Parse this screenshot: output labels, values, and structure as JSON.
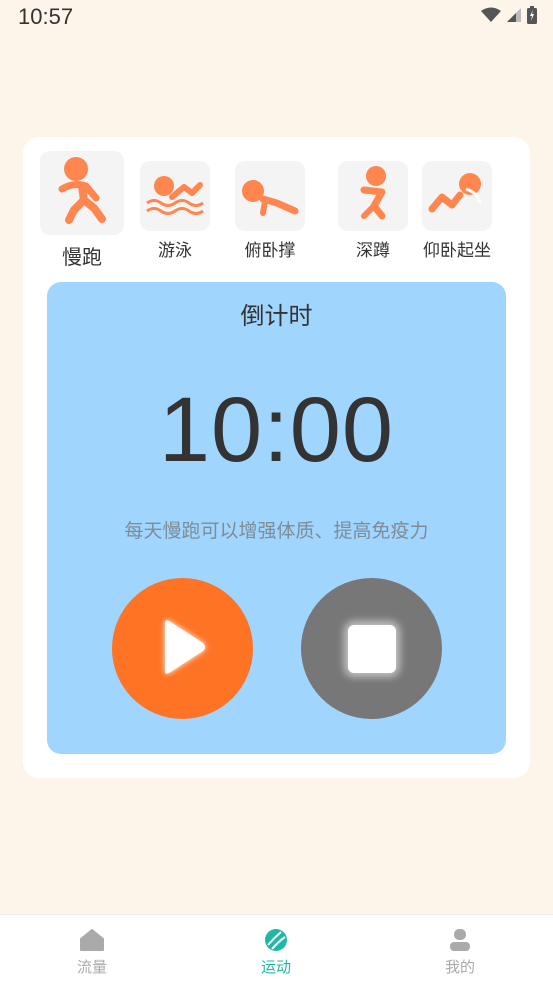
{
  "status_bar": {
    "time": "10:57"
  },
  "exercises": [
    {
      "label": "慢跑",
      "icon": "running-person-icon",
      "selected": true
    },
    {
      "label": "游泳",
      "icon": "swimming-person-icon",
      "selected": false
    },
    {
      "label": "俯卧撑",
      "icon": "pushup-person-icon",
      "selected": false
    },
    {
      "label": "深蹲",
      "icon": "squat-person-icon",
      "selected": false
    },
    {
      "label": "仰卧起坐",
      "icon": "situp-person-icon",
      "selected": false
    }
  ],
  "timer": {
    "title": "倒计时",
    "value": "10:00",
    "tip": "每天慢跑可以增强体质、提高免疫力"
  },
  "controls": {
    "play_icon": "play-icon",
    "stop_icon": "stop-icon"
  },
  "tabs": [
    {
      "label": "流量",
      "icon": "home-icon",
      "active": false
    },
    {
      "label": "运动",
      "icon": "ball-icon",
      "active": true
    },
    {
      "label": "我的",
      "icon": "user-icon",
      "active": false
    }
  ],
  "colors": {
    "background": "#FDF4EA",
    "accent_orange": "#FF7325",
    "icon_orange": "#FF864F",
    "timer_panel": "#A0D5FE",
    "stop_gray": "#777777",
    "tab_active": "#1EB8A5",
    "tab_inactive": "#AAAAAA"
  }
}
